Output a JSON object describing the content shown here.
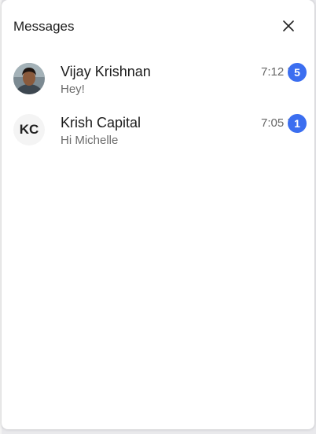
{
  "header": {
    "title": "Messages",
    "close_icon": "close-icon"
  },
  "conversations": [
    {
      "name": "Vijay Krishnan",
      "preview": "Hey!",
      "time": "7:12 PM",
      "unread": "5",
      "avatar": "photo"
    },
    {
      "name": "Krish Capital",
      "preview": "Hi Michelle",
      "time": "7:05 PM",
      "unread": "1",
      "avatar_initials": "KC"
    }
  ],
  "colors": {
    "badge": "#3b6ef0",
    "panel": "#ffffff"
  }
}
